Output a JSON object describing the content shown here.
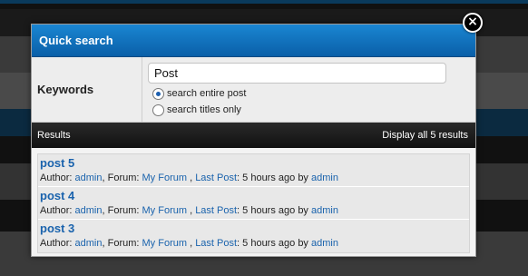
{
  "dialog": {
    "title": "Quick search",
    "close_icon": "×"
  },
  "form": {
    "keywords_label": "Keywords",
    "keywords_value": "Post",
    "options": [
      {
        "label": "search entire post",
        "checked": true
      },
      {
        "label": "search titles only",
        "checked": false
      }
    ]
  },
  "results_bar": {
    "label": "Results",
    "display_all": "Display all 5 results"
  },
  "results": [
    {
      "title": "post 5",
      "author_label": "Author: ",
      "author": "admin",
      "forum_label": ", Forum: ",
      "forum": "My Forum",
      "sep": " , ",
      "last_post_label": "Last Post",
      "time": ": 5 hours ago by ",
      "by": "admin"
    },
    {
      "title": "post 4",
      "author_label": "Author: ",
      "author": "admin",
      "forum_label": ", Forum: ",
      "forum": "My Forum",
      "sep": " , ",
      "last_post_label": "Last Post",
      "time": ": 5 hours ago by ",
      "by": "admin"
    },
    {
      "title": "post 3",
      "author_label": "Author: ",
      "author": "admin",
      "forum_label": ", Forum: ",
      "forum": "My Forum",
      "sep": " , ",
      "last_post_label": "Last Post",
      "time": ": 5 hours ago by ",
      "by": "admin"
    }
  ]
}
